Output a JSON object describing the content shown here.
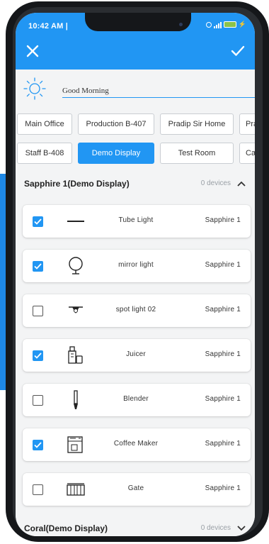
{
  "status_bar": {
    "time": "10:42 AM |"
  },
  "greeting": "Good Morning",
  "locations_row1": [
    "Main Office",
    "Production B-407",
    "Pradip Sir Home",
    "Pra"
  ],
  "locations_row2": [
    "Staff B-408",
    "Demo Display",
    "Test Room",
    "Ca"
  ],
  "active_location": "Demo Display",
  "section1": {
    "title": "Sapphire 1(Demo Display)",
    "count": "0 devices"
  },
  "section2": {
    "title": "Coral(Demo Display)",
    "count": "0 devices"
  },
  "devices": [
    {
      "name": "Tube Light",
      "room": "Sapphire 1",
      "checked": true,
      "icon": "tube-light-icon"
    },
    {
      "name": "mirror light",
      "room": "Sapphire 1",
      "checked": true,
      "icon": "mirror-light-icon"
    },
    {
      "name": "spot light 02",
      "room": "Sapphire 1",
      "checked": false,
      "icon": "spot-light-icon"
    },
    {
      "name": "Juicer",
      "room": "Sapphire 1",
      "checked": true,
      "icon": "juicer-icon"
    },
    {
      "name": "Blender",
      "room": "Sapphire 1",
      "checked": false,
      "icon": "blender-icon"
    },
    {
      "name": "Coffee Maker",
      "room": "Sapphire 1",
      "checked": true,
      "icon": "coffee-maker-icon"
    },
    {
      "name": "Gate",
      "room": "Sapphire 1",
      "checked": false,
      "icon": "gate-icon"
    }
  ],
  "colors": {
    "accent": "#2196f3",
    "background": "#f3f4f5"
  }
}
